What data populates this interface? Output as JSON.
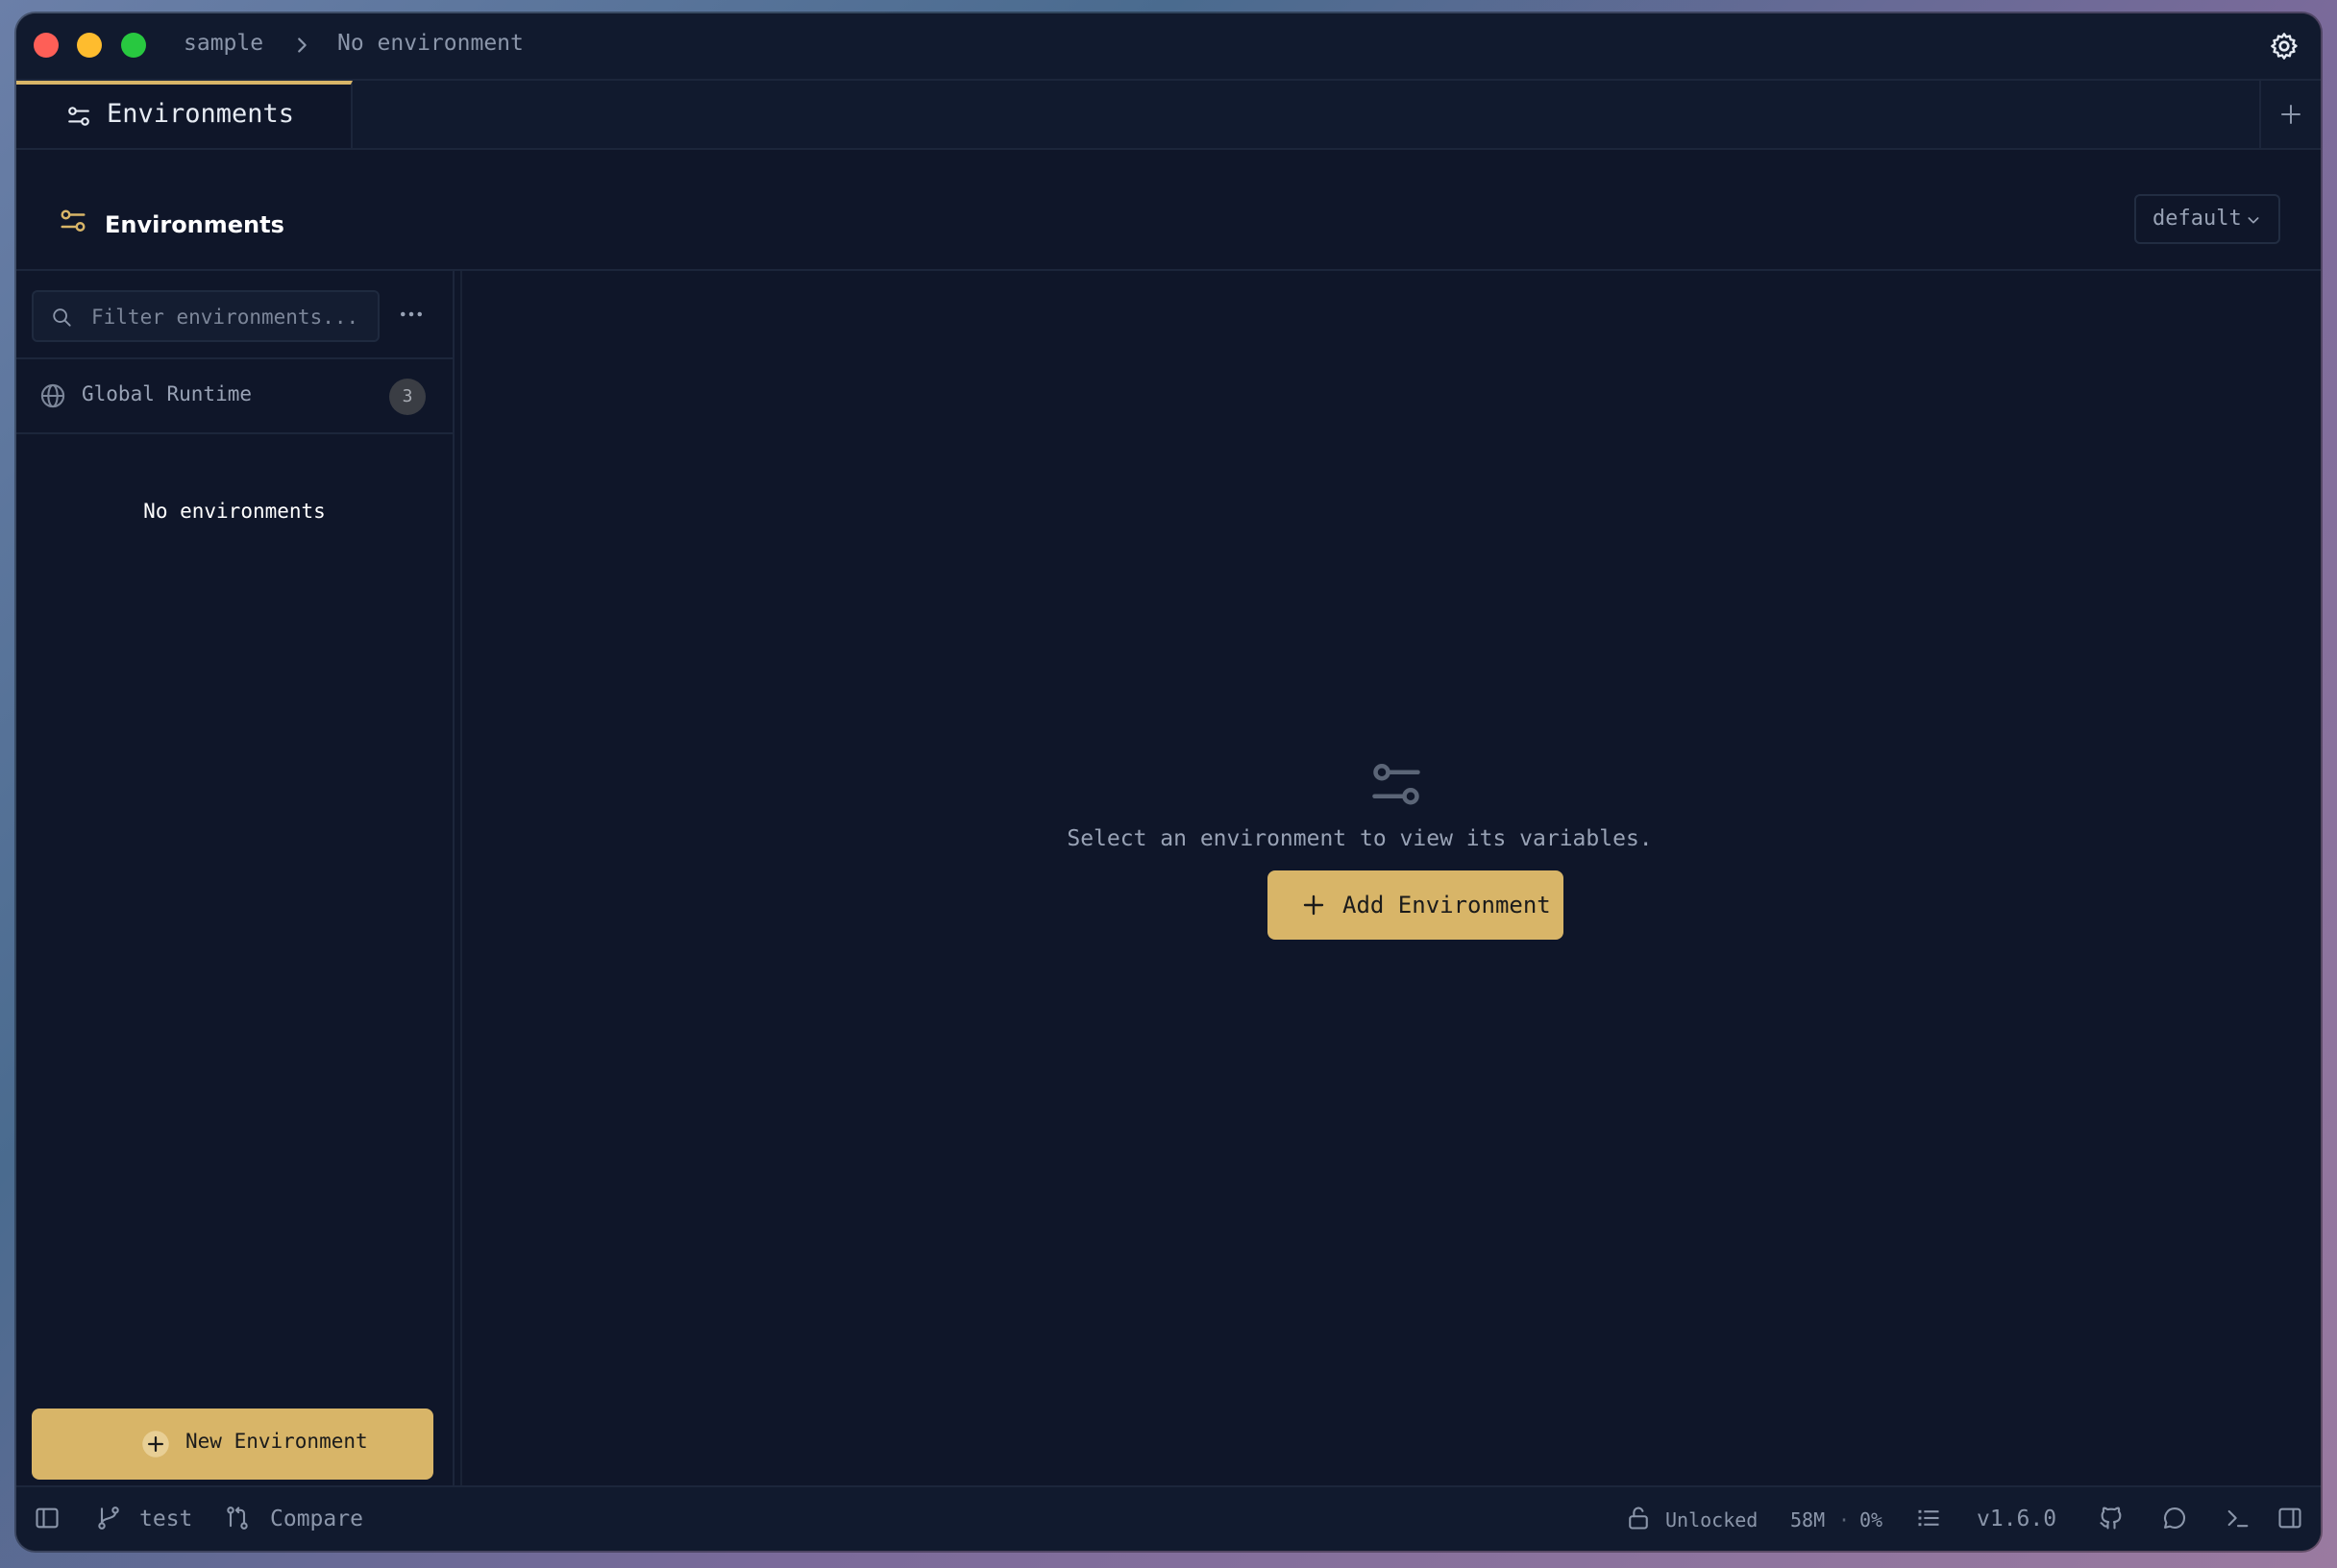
{
  "window": {
    "breadcrumb": {
      "project": "sample",
      "environment": "No environment"
    }
  },
  "tabs": [
    {
      "label": "Environments"
    }
  ],
  "header": {
    "title": "Environments",
    "select_value": "default"
  },
  "sidebar": {
    "filter_placeholder": "Filter environments...",
    "global": {
      "label": "Global Runtime",
      "count": "3"
    },
    "empty_text": "No environments",
    "new_button_label": "New Environment"
  },
  "main": {
    "empty_message": "Select an environment to view its variables.",
    "add_button_label": "Add Environment"
  },
  "statusbar": {
    "branch": "test",
    "compare": "Compare",
    "lock_status": "Unlocked",
    "memory": "58M",
    "separator": "·",
    "cpu": "0%",
    "version": "v1.6.0"
  },
  "colors": {
    "accent": "#d8b568",
    "background": "#0f1629",
    "panel": "#111a2e",
    "border": "#1c263b",
    "muted_text": "#8b96aa"
  }
}
